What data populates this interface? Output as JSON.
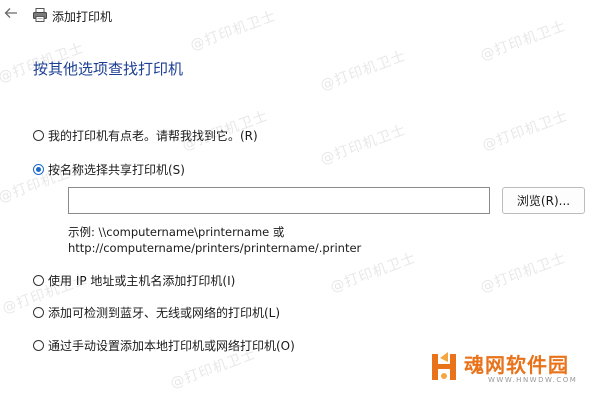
{
  "window": {
    "title": "添加打印机",
    "back_icon": "back-arrow-icon",
    "app_icon": "printer-icon"
  },
  "page": {
    "heading": "按其他选项查找打印机"
  },
  "options": [
    {
      "label": "我的打印机有点老。请帮我找到它。(R)",
      "checked": false
    },
    {
      "label": "按名称选择共享打印机(S)",
      "checked": true
    },
    {
      "label": "使用 IP 地址或主机名添加打印机(I)",
      "checked": false
    },
    {
      "label": "添加可检测到蓝牙、无线或网络的打印机(L)",
      "checked": false
    },
    {
      "label": "通过手动设置添加本地打印机或网络打印机(O)",
      "checked": false
    }
  ],
  "shared_printer": {
    "input_value": "",
    "browse_label": "浏览(R)...",
    "example_line1": "示例: \\\\computername\\printername 或",
    "example_line2": "http://computername/printers/printername/.printer"
  },
  "watermark": {
    "text": "@打印机卫士"
  },
  "logo": {
    "text": "魂网软件园",
    "url": "WWW.HNWDW.COM",
    "color": "#e8731a"
  },
  "colors": {
    "heading": "#1c3f94",
    "radio_accent": "#1b6ac9"
  }
}
